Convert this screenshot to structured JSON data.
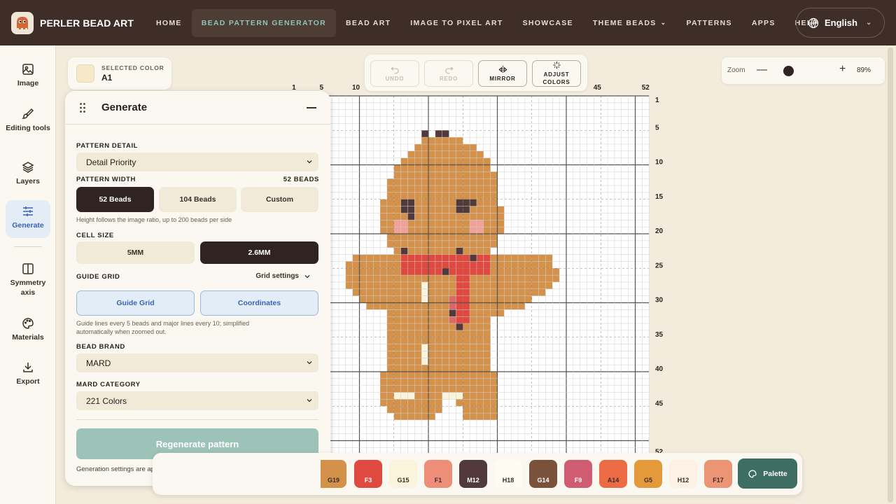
{
  "brand": {
    "name": "PERLER BEAD ART"
  },
  "nav": {
    "items": [
      {
        "label": "HOME"
      },
      {
        "label": "BEAD PATTERN GENERATOR"
      },
      {
        "label": "BEAD ART"
      },
      {
        "label": "IMAGE TO PIXEL ART"
      },
      {
        "label": "SHOWCASE"
      },
      {
        "label": "THEME BEADS"
      },
      {
        "label": "PATTERNS"
      },
      {
        "label": "APPS"
      },
      {
        "label": "HELP"
      }
    ],
    "active_index": 1,
    "language": "English"
  },
  "rail": {
    "items": [
      {
        "label": "Image",
        "icon": "image-icon"
      },
      {
        "label": "Editing tools",
        "icon": "brush-icon"
      },
      {
        "label": "Layers",
        "icon": "layers-icon"
      },
      {
        "label": "Generate",
        "icon": "sliders-icon"
      },
      {
        "label": "Symmetry axis",
        "icon": "symmetry-icon"
      },
      {
        "label": "Materials",
        "icon": "palette-icon"
      },
      {
        "label": "Export",
        "icon": "download-icon"
      }
    ],
    "active": "Generate"
  },
  "selected_color": {
    "label": "SELECTED COLOR",
    "value": "A1",
    "hex": "#f5e9c9"
  },
  "toolbar": {
    "undo": "UNDO",
    "redo": "REDO",
    "mirror": "MIRROR",
    "adjust": "ADJUST COLORS"
  },
  "zoom": {
    "label": "Zoom",
    "value": "89%",
    "level": 0.89
  },
  "grid": {
    "top_labels": [
      "1",
      "5",
      "10",
      "45",
      "52"
    ],
    "side_labels": [
      "1",
      "5",
      "10",
      "15",
      "20",
      "25",
      "30",
      "35",
      "40",
      "45",
      "52"
    ]
  },
  "panel": {
    "title": "Generate",
    "pattern_detail": {
      "label": "PATTERN DETAIL",
      "value": "Detail Priority"
    },
    "pattern_width": {
      "label": "PATTERN WIDTH",
      "value": "52 BEADS",
      "options": [
        "52 Beads",
        "104 Beads",
        "Custom"
      ],
      "selected": "52 Beads",
      "hint": "Height follows the image ratio, up to 200 beads per side"
    },
    "cell_size": {
      "label": "CELL SIZE",
      "options": [
        "5MM",
        "2.6MM"
      ],
      "selected": "2.6MM"
    },
    "guide_grid": {
      "label": "GUIDE GRID",
      "settings": "Grid settings",
      "toggles": [
        "Guide Grid",
        "Coordinates"
      ],
      "hint": "Guide lines every 5 beads and major lines every 10; simplified automatically when zoomed out."
    },
    "bead_brand": {
      "label": "BEAD BRAND",
      "value": "MARD"
    },
    "category": {
      "label": "MARD CATEGORY",
      "value": "221 Colors"
    },
    "regenerate": "Regenerate pattern",
    "status": "Generation settings are applied."
  },
  "palette": {
    "chips": [
      {
        "code": "G19",
        "color": "#d3914a",
        "text": "#3a2f29"
      },
      {
        "code": "F3",
        "color": "#e0493f",
        "text": "#ffffff"
      },
      {
        "code": "G15",
        "color": "#fbf4dc",
        "text": "#3a2f29"
      },
      {
        "code": "F1",
        "color": "#ee8e78",
        "text": "#3a2f29"
      },
      {
        "code": "M12",
        "color": "#523a3a",
        "text": "#ffffff"
      },
      {
        "code": "H18",
        "color": "#fdfbf2",
        "text": "#3a2f29"
      },
      {
        "code": "G14",
        "color": "#7a523b",
        "text": "#ffffff"
      },
      {
        "code": "F9",
        "color": "#cf5c70",
        "text": "#ffffff"
      },
      {
        "code": "A14",
        "color": "#ec6a44",
        "text": "#3a2f29"
      },
      {
        "code": "G5",
        "color": "#e49a3a",
        "text": "#3a2f29"
      },
      {
        "code": "H12",
        "color": "#fdf1e6",
        "text": "#3a2f29"
      },
      {
        "code": "F17",
        "color": "#eb9575",
        "text": "#3a2f29"
      }
    ],
    "button": "Palette"
  },
  "colors": {
    "topbar": "#3e2e27",
    "accent": "#3e6e63",
    "bead_body": "#d3914a",
    "bead_dark": "#523a3a",
    "bead_red": "#e0493f"
  }
}
